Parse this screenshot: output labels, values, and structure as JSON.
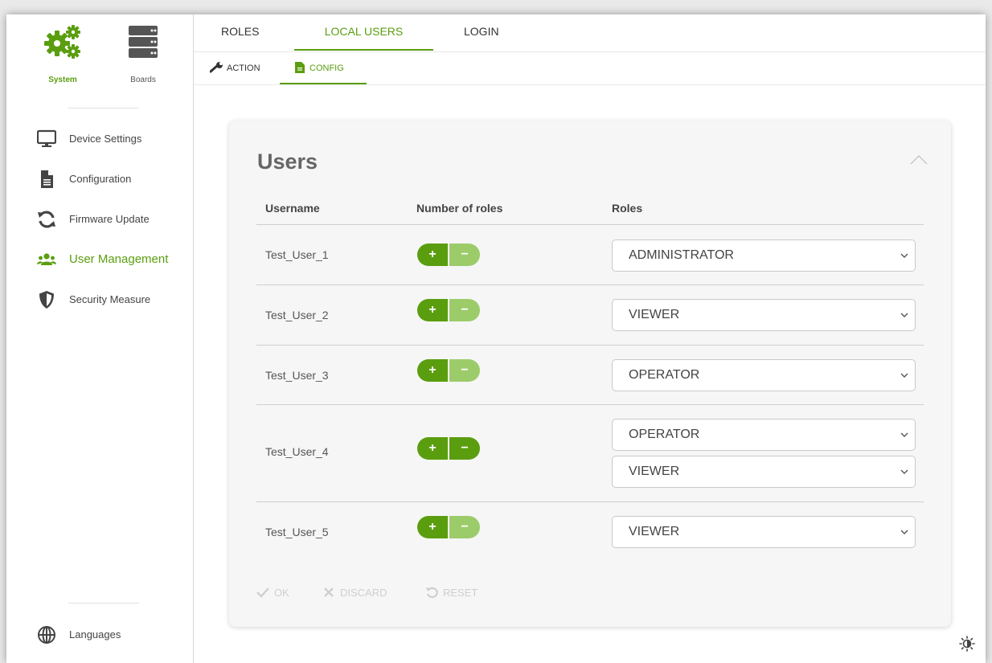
{
  "sidebar": {
    "top": {
      "system_label": "System",
      "boards_label": "Boards"
    },
    "items": [
      {
        "label": "Device Settings",
        "icon": "monitor-icon"
      },
      {
        "label": "Configuration",
        "icon": "document-icon"
      },
      {
        "label": "Firmware Update",
        "icon": "refresh-icon"
      },
      {
        "label": "User Management",
        "icon": "users-icon"
      },
      {
        "label": "Security Measure",
        "icon": "shield-icon"
      }
    ],
    "languages_label": "Languages"
  },
  "tabs": [
    {
      "label": "ROLES"
    },
    {
      "label": "LOCAL USERS"
    },
    {
      "label": "LOGIN"
    }
  ],
  "subtabs": [
    {
      "label": "ACTION"
    },
    {
      "label": "CONFIG"
    }
  ],
  "card": {
    "title": "Users",
    "headers": {
      "username": "Username",
      "count": "Number of roles",
      "roles": "Roles"
    },
    "rows": [
      {
        "username": "Test_User_1",
        "roles": [
          "ADMINISTRATOR"
        ]
      },
      {
        "username": "Test_User_2",
        "roles": [
          "VIEWER"
        ]
      },
      {
        "username": "Test_User_3",
        "roles": [
          "OPERATOR"
        ]
      },
      {
        "username": "Test_User_4",
        "roles": [
          "OPERATOR",
          "VIEWER"
        ]
      },
      {
        "username": "Test_User_5",
        "roles": [
          "VIEWER"
        ]
      }
    ],
    "plus_label": "+",
    "minus_label": "−",
    "actions": {
      "ok": "OK",
      "discard": "DISCARD",
      "reset": "RESET"
    }
  },
  "colors": {
    "accent": "#5a9e0f",
    "accent_light": "#9ccc6a"
  }
}
